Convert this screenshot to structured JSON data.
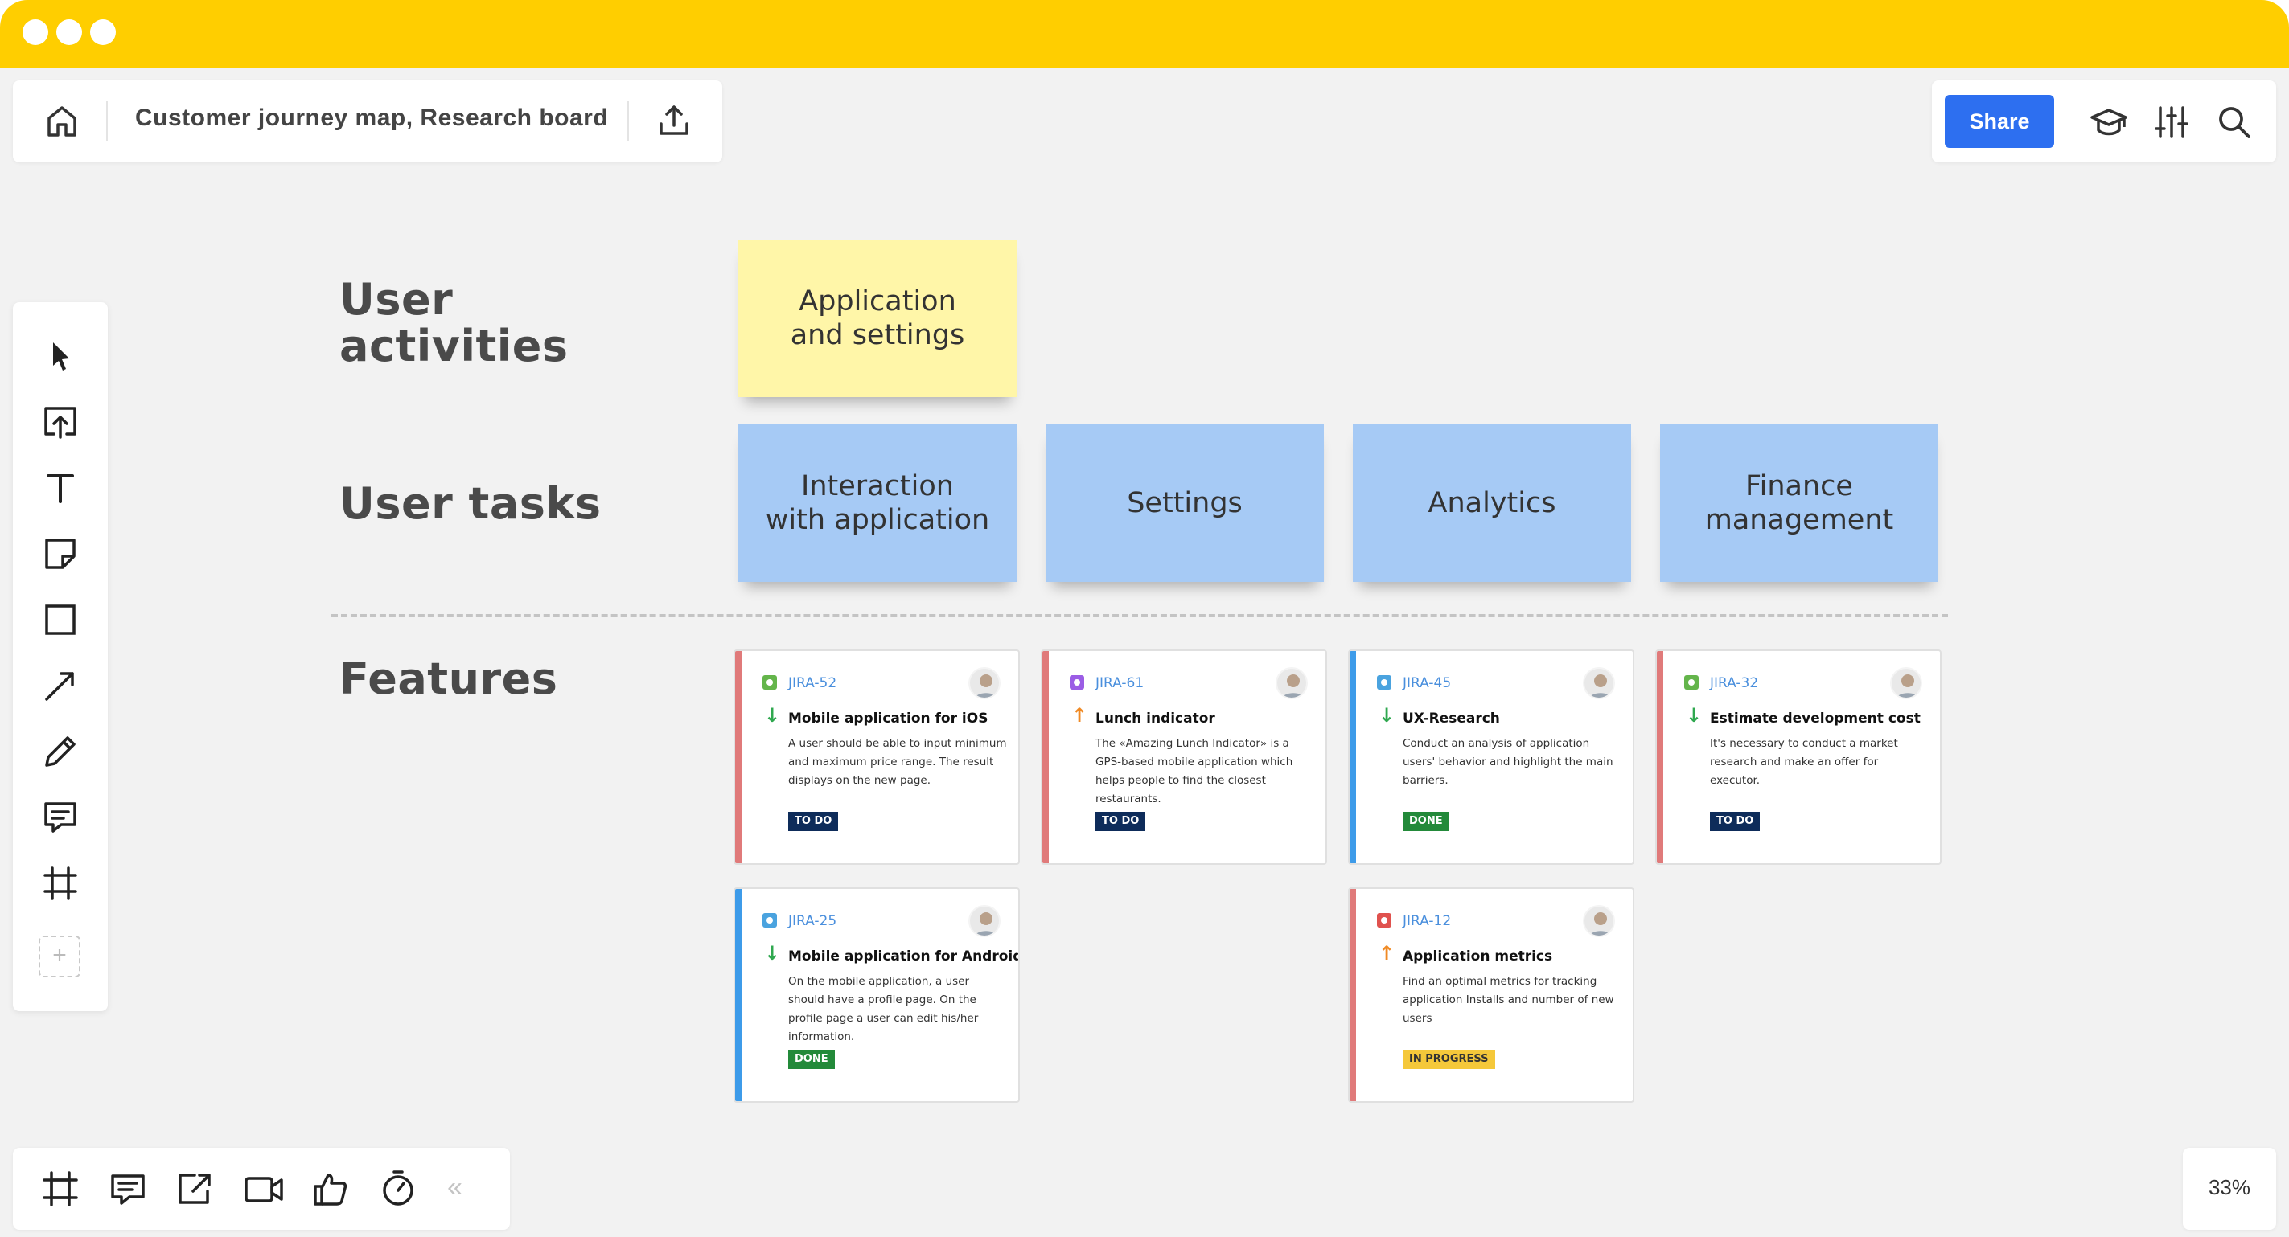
{
  "window": {
    "dots": [
      "close",
      "minimize",
      "maximize"
    ]
  },
  "board": {
    "title": "Customer journey map, Research board",
    "icons": {
      "home": "home-icon",
      "export": "upload-icon"
    }
  },
  "toolbar_right": {
    "share_label": "Share",
    "icons": [
      "graduation-cap-icon",
      "sliders-icon",
      "search-icon"
    ]
  },
  "left_toolbar": {
    "tools": [
      "select-cursor-icon",
      "upload-icon",
      "text-icon",
      "sticky-note-icon",
      "rectangle-icon",
      "arrow-line-icon",
      "pen-icon",
      "comment-icon",
      "frame-icon"
    ],
    "add_label": "+"
  },
  "bottom_toolbar": {
    "tools": [
      "frames-icon",
      "comments-icon",
      "screen-share-icon",
      "video-call-icon",
      "voting-icon",
      "timer-icon"
    ],
    "collapse_label": "«"
  },
  "zoom": {
    "label": "33%"
  },
  "rows": {
    "activities": "User\nactivities",
    "tasks": "User tasks",
    "features": "Features"
  },
  "activities": [
    {
      "label": "Application\nand settings"
    }
  ],
  "tasks": [
    {
      "label": "Interaction\nwith application"
    },
    {
      "label": "Settings"
    },
    {
      "label": "Analytics"
    },
    {
      "label": "Finance\nmanagement"
    }
  ],
  "cards": [
    {
      "key": "JIRA-52",
      "title": "Mobile application for iOS",
      "desc": "A user should be able to input minimum and maximum price range. The result displays on the new page.",
      "status": "TO DO",
      "priority": "low",
      "type_color": "#64b54b",
      "stripe": "#e07a7a"
    },
    {
      "key": "JIRA-61",
      "title": "Lunch indicator",
      "desc": "The «Amazing Lunch Indicator» is a GPS-based mobile application which helps people to find the closest restaurants.",
      "status": "TO DO",
      "priority": "high",
      "type_color": "#9b5de5",
      "stripe": "#e07a7a"
    },
    {
      "key": "JIRA-45",
      "title": "UX-Research",
      "desc": "Conduct an analysis of application users' behavior and highlight the main barriers.",
      "status": "DONE",
      "priority": "low",
      "type_color": "#4aa3df",
      "stripe": "#3d9be9"
    },
    {
      "key": "JIRA-32",
      "title": "Estimate development cost",
      "desc": "It's necessary to conduct a market research and make an offer for executor.",
      "status": "TO DO",
      "priority": "low",
      "type_color": "#64b54b",
      "stripe": "#e07a7a"
    },
    {
      "key": "JIRA-25",
      "title": "Mobile application for Android",
      "desc": "On the mobile application, a user should have a profile page. On the profile page a user can edit his/her information.",
      "status": "DONE",
      "priority": "low",
      "type_color": "#4aa3df",
      "stripe": "#3d9be9"
    },
    {
      "key": "JIRA-12",
      "title": "Application metrics",
      "desc": "Find an optimal metrics for tracking application Installs and number of new users",
      "status": "IN PROGRESS",
      "priority": "high",
      "type_color": "#e0524e",
      "stripe": "#e07a7a"
    }
  ],
  "priority_glyphs": {
    "low": "↓",
    "high": "↑"
  },
  "priority_colors": {
    "low": "#2fa84f",
    "high": "#f08a24"
  },
  "status_colors": {
    "TO DO": {
      "bg": "#0e2c5a",
      "fg": "#ffffff"
    },
    "DONE": {
      "bg": "#238a3a",
      "fg": "#ffffff"
    },
    "IN PROGRESS": {
      "bg": "#f5c83a",
      "fg": "#333333"
    }
  }
}
